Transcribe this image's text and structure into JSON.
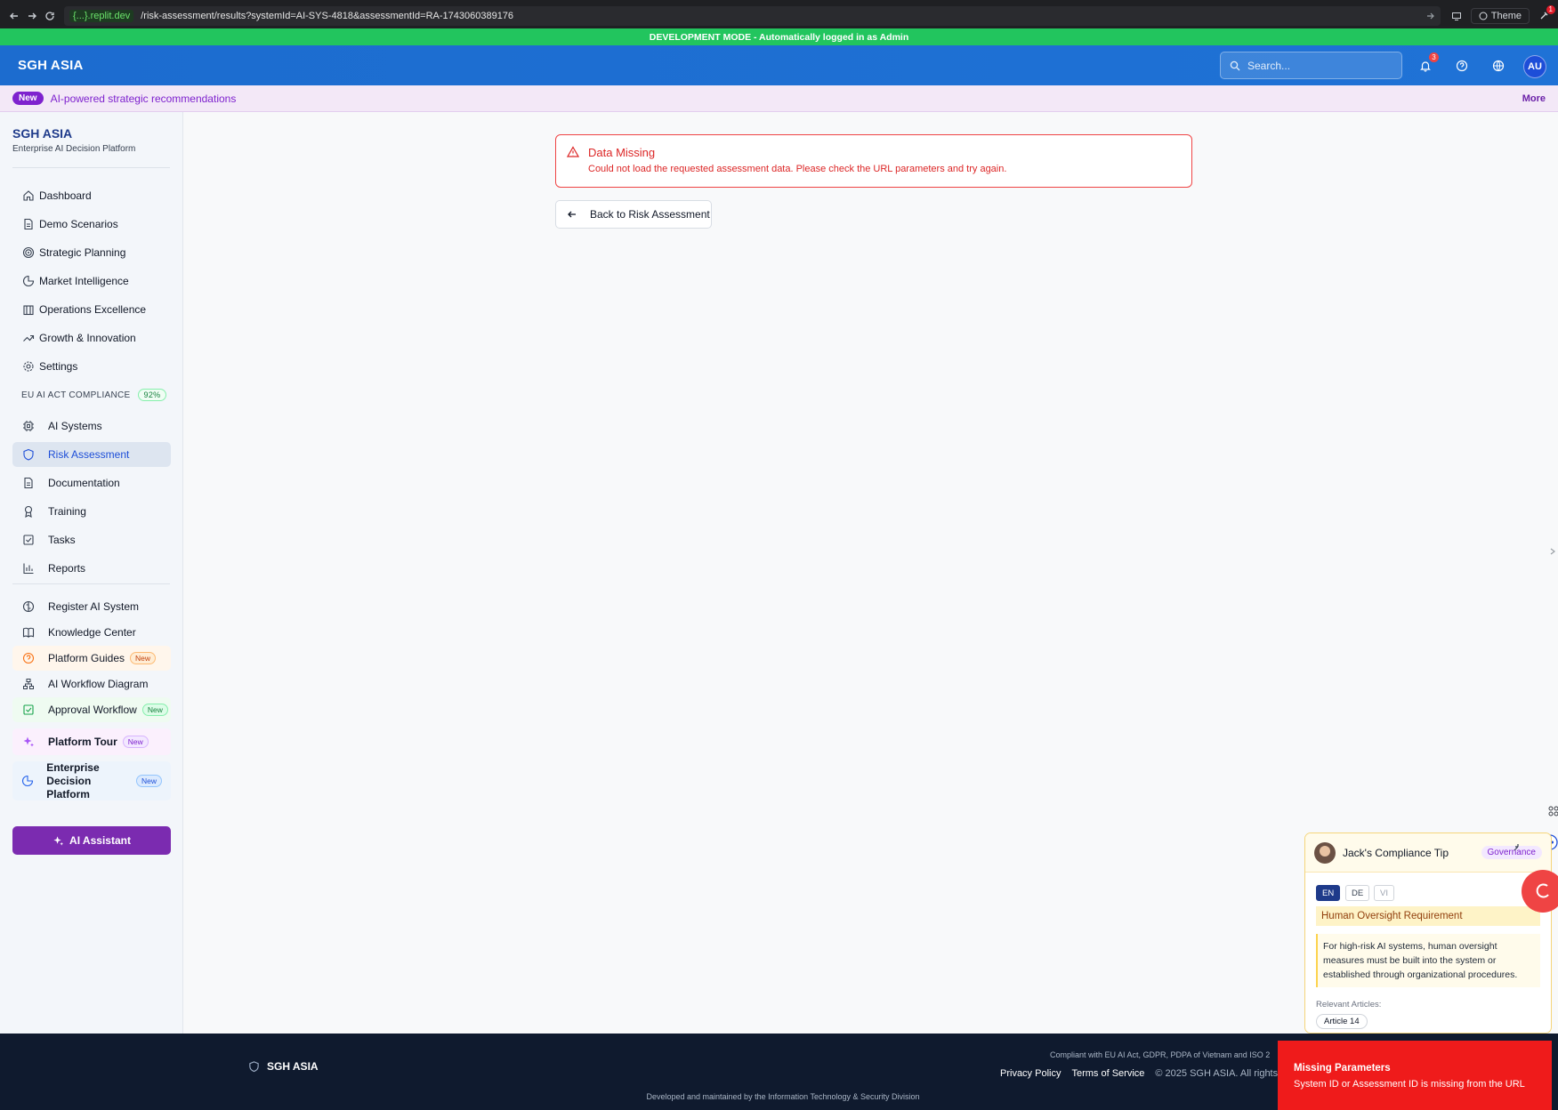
{
  "browser": {
    "host": "{...}.replit.dev",
    "path": "/risk-assessment/results?systemId=AI-SYS-4818&assessmentId=RA-1743060389176",
    "theme_label": "Theme",
    "ext_badge": "1"
  },
  "dev_banner": "DEVELOPMENT MODE - Automatically logged in as Admin",
  "header": {
    "brand": "SGH ASIA",
    "search_placeholder": "Search...",
    "notification_count": "3",
    "avatar_initials": "AU"
  },
  "announcement": {
    "pill": "New",
    "text": "AI-powered strategic recommendations",
    "more": "More"
  },
  "sidebar": {
    "title": "SGH ASIA",
    "subtitle": "Enterprise AI Decision Platform",
    "primary": [
      {
        "label": "Dashboard",
        "icon": "home-icon"
      },
      {
        "label": "Demo Scenarios",
        "icon": "document-icon"
      },
      {
        "label": "Strategic Planning",
        "icon": "target-icon"
      },
      {
        "label": "Market Intelligence",
        "icon": "pie-chart-icon"
      },
      {
        "label": "Operations Excellence",
        "icon": "building-icon"
      },
      {
        "label": "Growth & Innovation",
        "icon": "trending-up-icon"
      },
      {
        "label": "Settings",
        "icon": "gear-icon"
      }
    ],
    "section_title": "EU AI ACT COMPLIANCE",
    "section_percent": "92%",
    "compliance": [
      {
        "label": "AI Systems",
        "icon": "cpu-icon"
      },
      {
        "label": "Risk Assessment",
        "icon": "shield-icon",
        "active": true
      },
      {
        "label": "Documentation",
        "icon": "document-icon"
      },
      {
        "label": "Training",
        "icon": "award-icon"
      },
      {
        "label": "Tasks",
        "icon": "checkbox-icon"
      },
      {
        "label": "Reports",
        "icon": "bar-chart-icon"
      }
    ],
    "extra": [
      {
        "label": "Register AI System",
        "icon": "brain-icon"
      },
      {
        "label": "Knowledge Center",
        "icon": "book-icon"
      },
      {
        "label": "Platform Guides",
        "icon": "help-circle-icon",
        "badge": "New"
      },
      {
        "label": "AI Workflow Diagram",
        "icon": "workflow-icon"
      },
      {
        "label": "Approval Workflow",
        "icon": "checkbox-icon",
        "badge": "New"
      },
      {
        "label": "Platform Tour",
        "icon": "sparkles-icon",
        "badge": "New"
      },
      {
        "label": "Enterprise Decision",
        "label2": "Platform",
        "icon": "pie-chart-icon",
        "badge": "New"
      }
    ],
    "ai_button": "AI Assistant"
  },
  "main": {
    "alert_title": "Data Missing",
    "alert_message": "Could not load the requested assessment data. Please check the URL parameters and try again.",
    "back_button": "Back to Risk Assessment"
  },
  "tip": {
    "title": "Jack's Compliance Tip",
    "tag": "Governance",
    "languages": [
      "EN",
      "DE",
      "VI"
    ],
    "selected_language": "EN",
    "heading": "Human Oversight Requirement",
    "body": "For high-risk AI systems, human oversight measures must be built into the system or established through organizational procedures.",
    "relevant_label": "Relevant Articles:",
    "article": "Article 14"
  },
  "footer": {
    "brand": "SGH ASIA",
    "compliance": "Compliant with EU AI Act, GDPR, PDPA of Vietnam and ISO 2",
    "privacy": "Privacy Policy",
    "terms": "Terms of Service",
    "copyright": "© 2025 SGH ASIA. All rights",
    "developed": "Developed and maintained by the Information Technology & Security Division"
  },
  "toast": {
    "title": "Missing Parameters",
    "message": "System ID or Assessment ID is missing from the URL"
  },
  "colors": {
    "header": "#1f72d6",
    "dev_banner": "#22c55e",
    "accent_purple": "#7b2bb0",
    "error_red": "#dc2626",
    "footer": "#0f1a2e"
  }
}
